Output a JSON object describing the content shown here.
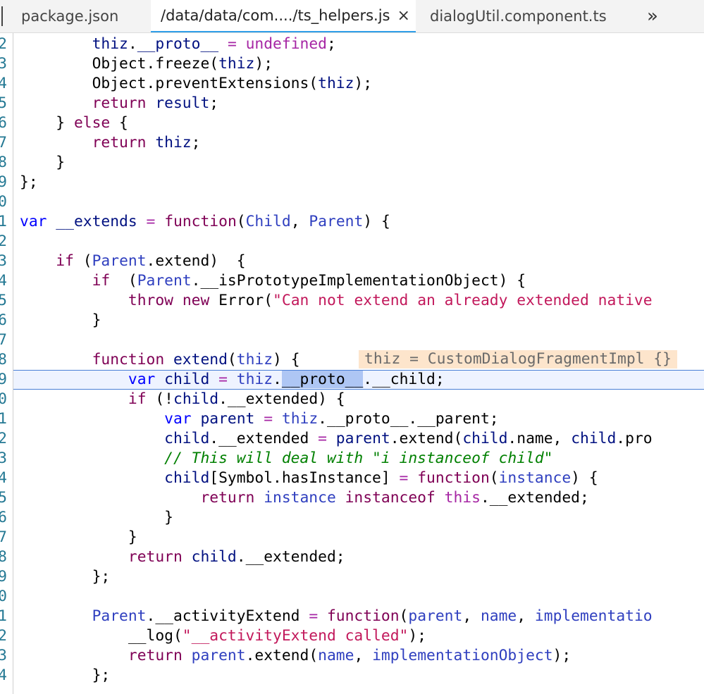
{
  "tabs": [
    {
      "label": "package.json"
    },
    {
      "label": "/data/data/com..../ts_helpers.js",
      "active": true,
      "close": "×"
    },
    {
      "label": "dialogUtil.component.ts"
    }
  ],
  "overflow": "»",
  "inline_hint": "thiz = CustomDialogFragmentImpl {}",
  "line_numbers": [
    "2",
    "3",
    "4",
    "5",
    "6",
    "7",
    "8",
    "9",
    "0",
    "1",
    "2",
    "3",
    "4",
    "5",
    "6",
    "7",
    "8",
    "9",
    "0",
    "1",
    "2",
    "3",
    "4",
    "5",
    "6",
    "7",
    "8",
    "9",
    "0",
    "1",
    "2",
    "3",
    "4"
  ],
  "colors": {
    "tab_active_underline": "#2f9ee8",
    "current_line_border": "#4a7fd6",
    "hint_background": "#fde5cc",
    "selection": "#aec6f4"
  }
}
